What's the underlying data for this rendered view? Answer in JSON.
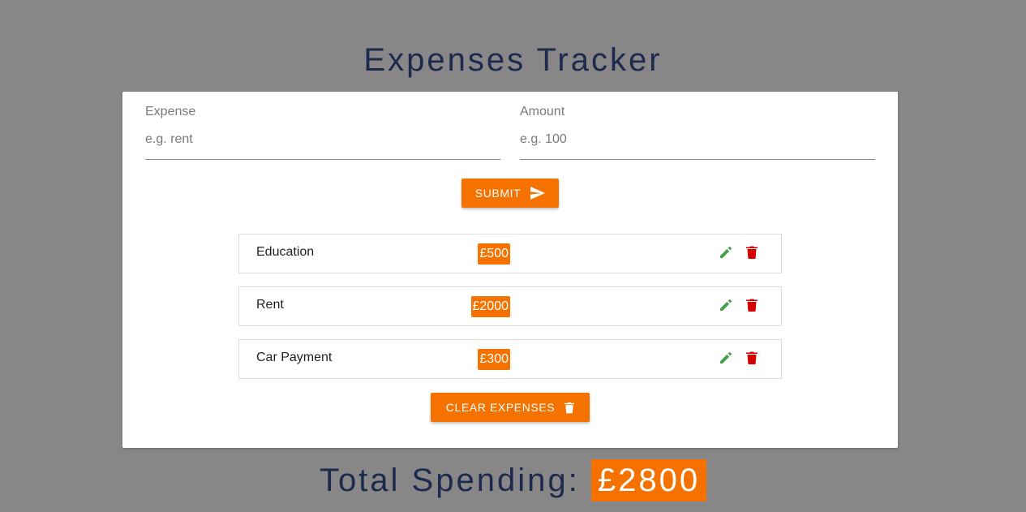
{
  "header": {
    "title": "Expenses Tracker"
  },
  "form": {
    "expense_label": "Expense",
    "expense_placeholder": "e.g. rent",
    "expense_value": "",
    "amount_label": "Amount",
    "amount_placeholder": "e.g. 100",
    "amount_value": "",
    "submit_label": "Submit",
    "submit_icon": "send-icon"
  },
  "expenses": [
    {
      "name": "Education",
      "amount": "£500"
    },
    {
      "name": "Rent",
      "amount": "£2000"
    },
    {
      "name": "Car Payment",
      "amount": "£300"
    }
  ],
  "actions": {
    "edit_icon": "pencil-icon",
    "delete_icon": "trash-icon",
    "clear_label": "Clear Expenses",
    "clear_icon": "trash-icon"
  },
  "footer": {
    "total_label": "Total Spending:",
    "total_amount": "£2800"
  },
  "colors": {
    "background": "#888687",
    "accent": "#f57200",
    "title": "#1c2a4e",
    "edit": "#43a047",
    "delete": "#d50000"
  }
}
